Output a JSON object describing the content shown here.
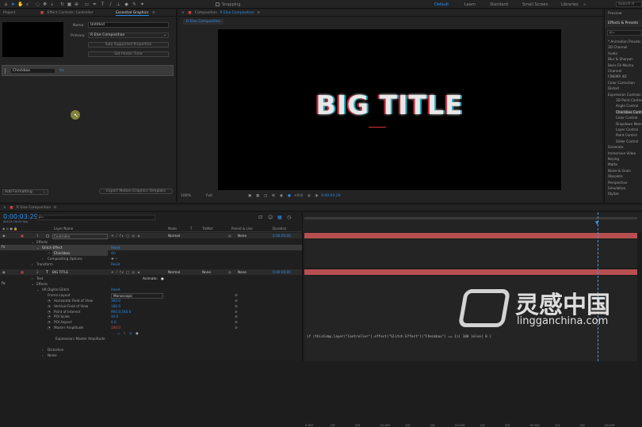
{
  "toolbar": {
    "snapping": "Snapping",
    "workspaces": [
      "Default",
      "Learn",
      "Standard",
      "Small Screen",
      "Libraries"
    ],
    "search_placeholder": "Search H"
  },
  "left_panel": {
    "tab_project": "Project",
    "tab_effect_controls": "Effect Controls: Controller",
    "tab_essential": "Essential Graphics",
    "name_label": "Name:",
    "name_value": "Untitled",
    "primary_label": "Primary:",
    "primary_value": "R Else Composition",
    "solo_btn": "Solo Supported Properties",
    "poster_btn": "Set Poster Time",
    "item_name": "Checkbox",
    "item_value": "On",
    "add_formatting": "Add Formatting",
    "export_btn": "Export Motion Graphics Template"
  },
  "comp": {
    "tab": "Composition",
    "tab_name": "R Else Composition",
    "breadcrumb": "R Else Composition",
    "title": "BIG TITLE",
    "zoom": "100%",
    "quality": "Full",
    "timecode": "0:00:03:29",
    "plus": "+0.0"
  },
  "effects": {
    "header_preview": "Preview",
    "header": "Effects & Presets",
    "search": "ρ=",
    "items": [
      "* Animation Presets",
      "3D Channel",
      "Audio",
      "Blur & Sharpen",
      "Boris FX Mocha",
      "Channel",
      "CINEMA 4D",
      "Color Correction",
      "Distort",
      "Expression Controls",
      "3D Point Control",
      "Angle Control",
      "Checkbox Control",
      "Color Control",
      "Dropdown Menu Control",
      "Layer Control",
      "Point Control",
      "Slider Control",
      "Generate",
      "Immersive Video",
      "Keying",
      "Matte",
      "Noise & Grain",
      "Obsolete",
      "Perspective",
      "Simulation",
      "Stylize"
    ]
  },
  "timeline": {
    "tab": "R Else Composition",
    "timecode": "0:00:03:29",
    "timecode_sub": "00119 (30.00 fps)",
    "search": "ρ=",
    "col_layer": "Layer Name",
    "col_mode": "Mode",
    "col_t": "T",
    "col_trkmat": "TrkMat",
    "col_parent": "Parent & Link",
    "col_duration": "Duration",
    "ruler": [
      "0:00f",
      "10f",
      "20f",
      "01:00f",
      "10f",
      "20f",
      "02:00f",
      "10f",
      "20f",
      "03:00f",
      "10f",
      "20f",
      "04:00f"
    ],
    "layer1": {
      "num": "1",
      "name": "Controller",
      "mode": "Normal",
      "parent": "None",
      "duration": "0:00:05:00"
    },
    "effects_label": "Effects",
    "glitch": "Glitch Effect",
    "glitch_reset": "Reset",
    "checkbox": "Checkbox",
    "checkbox_val": "On",
    "compositing": "Compositing Options",
    "transform": "Transform",
    "transform_reset": "Reset",
    "layer2": {
      "num": "2",
      "name": "BIG TITLE",
      "mode": "Normal",
      "trkmat": "None",
      "parent": "None",
      "duration": "0:00:05:00"
    },
    "text_label": "Text",
    "animate": "Animate:",
    "effects2": "Effects",
    "vr": "VR Digital Glitch",
    "vr_reset": "Reset",
    "frame_layout": "Frame Layout",
    "frame_layout_val": "Monoscopic",
    "props": [
      {
        "name": "Horizontal Field of View",
        "val": "360.0"
      },
      {
        "name": "Vertical Field of View",
        "val": "180.0"
      },
      {
        "name": "Point of Interest",
        "val": "960.0,540.0"
      },
      {
        "name": "POI Scale",
        "val": "10.0"
      },
      {
        "name": "POI Aspect",
        "val": "0.0"
      },
      {
        "name": "Master Amplitude",
        "val": "100.0"
      }
    ],
    "expression_label": "Expression: Master Amplitude",
    "distortion": "Distortion",
    "noise": "Noise",
    "expression_code": "if (thisComp.layer(\"Controller\").effect(\"Glitch Effect\")(\"Checkbox\") == 1){ 100 }else{ 0  }"
  },
  "watermark": {
    "cn": "灵感中国",
    "url": "lingganchina.com"
  },
  "colors": {
    "accent": "#2d8ceb",
    "layer_bar": "#b74f50",
    "playhead": "#3e9ae0"
  }
}
